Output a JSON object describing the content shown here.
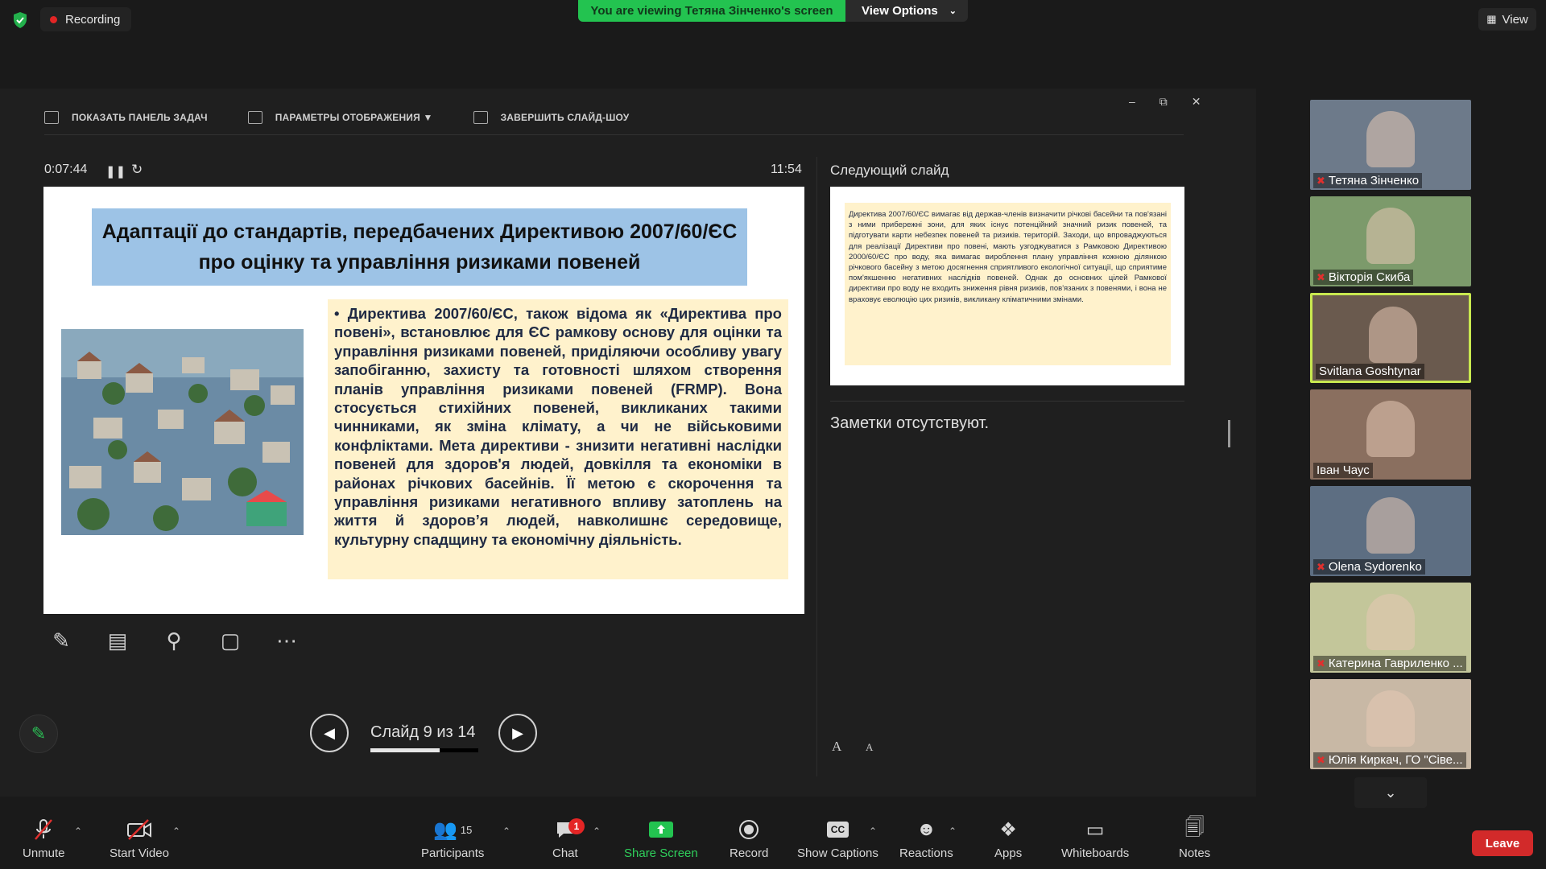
{
  "top_bar": {
    "recording_label": "Recording",
    "viewing_banner": "You are viewing Тетяна Зінченко's screen",
    "view_options_label": "View Options",
    "view_label": "View"
  },
  "presenter": {
    "toolbar": {
      "taskbar_label": "ПОКАЗАТЬ ПАНЕЛЬ ЗАДАЧ",
      "display_settings_label": "ПАРАМЕТРЫ ОТОБРАЖЕНИЯ ▼",
      "end_show_label": "ЗАВЕРШИТЬ СЛАЙД-ШОУ"
    },
    "timer": "0:07:44",
    "clock": "11:54",
    "current_slide": {
      "title": "Адаптації до стандартів, передбачених Директивою 2007/60/ЄС про оцінку та управління ризиками повеней",
      "body": "• Директива 2007/60/ЄС, також відома як «Директива про повені», встановлює для ЄС рамкову основу для оцінки та управління ризиками повеней, приділяючи особливу увагу запобіганню, захисту та готовності шляхом створення планів управління ризиками повеней (FRMP). Вона стосується стихійних повеней, викликаних такими чинниками, як зміна клімату, а чи не військовими конфліктами. Мета директиви - знизити негативні наслідки повеней для здоров'я людей, довкілля та економіки в районах річкових басейнів. Її метою є скорочення та управління ризиками негативного впливу затоплень на життя й здоров’я людей, навколишнє середовище, культурну спадщину та економічну діяльність."
    },
    "next_slide_label": "Следующий слайд",
    "next_slide_text": "Директива 2007/60/ЄС вимагає від держав-членів визначити річкові басейни та пов'язані з ними прибережні зони, для яких існує потенційний значний ризик повеней, та підготувати карти небезпек повеней та ризиків. територій. Заходи, що впроваджуються для реалізації Директиви про повені, мають узгоджуватися з Рамковою Директивою 2000/60/ЄС про воду, яка вимагає вироблення плану управління кожною ділянкою річкового басейну з метою досягнення сприятливого екологічної ситуації, що сприятиме пом'якшенню негативних наслідків повеней. Однак до основних цілей Рамкової директиви про воду не входить зниження рівня ризиків, пов'язаних з повенями, і вона не враховує еволюцію цих ризиків, викликану кліматичними змінами.",
    "notes_text": "Заметки отсутствуют.",
    "slide_counter": "Слайд 9 из 14",
    "slide_progress": 0.64,
    "font_increase_glyph": "A",
    "font_decrease_glyph": "A"
  },
  "participants": [
    {
      "name": "Тетяна Зінченко",
      "muted": true
    },
    {
      "name": "Вікторія Скиба",
      "muted": true
    },
    {
      "name": "Svitlana Goshtynar",
      "muted": false,
      "active": true
    },
    {
      "name": "Іван Чаус",
      "muted": false
    },
    {
      "name": "Olena Sydorenko",
      "muted": true
    },
    {
      "name": "Катерина Гавриленко ...",
      "muted": true
    },
    {
      "name": "Юлія Киркач, ГО \"Сіве...",
      "muted": true
    }
  ],
  "toolbar": {
    "unmute": "Unmute",
    "start_video": "Start Video",
    "participants": "Participants",
    "participants_count": "15",
    "chat": "Chat",
    "chat_badge": "1",
    "share_screen": "Share Screen",
    "record": "Record",
    "show_captions": "Show Captions",
    "captions_icon_text": "CC",
    "reactions": "Reactions",
    "apps": "Apps",
    "whiteboards": "Whiteboards",
    "notes": "Notes",
    "leave": "Leave"
  },
  "colors": {
    "accent_green": "#23c350",
    "leave_red": "#d22a2a",
    "active_speaker": "#c8e84f"
  }
}
